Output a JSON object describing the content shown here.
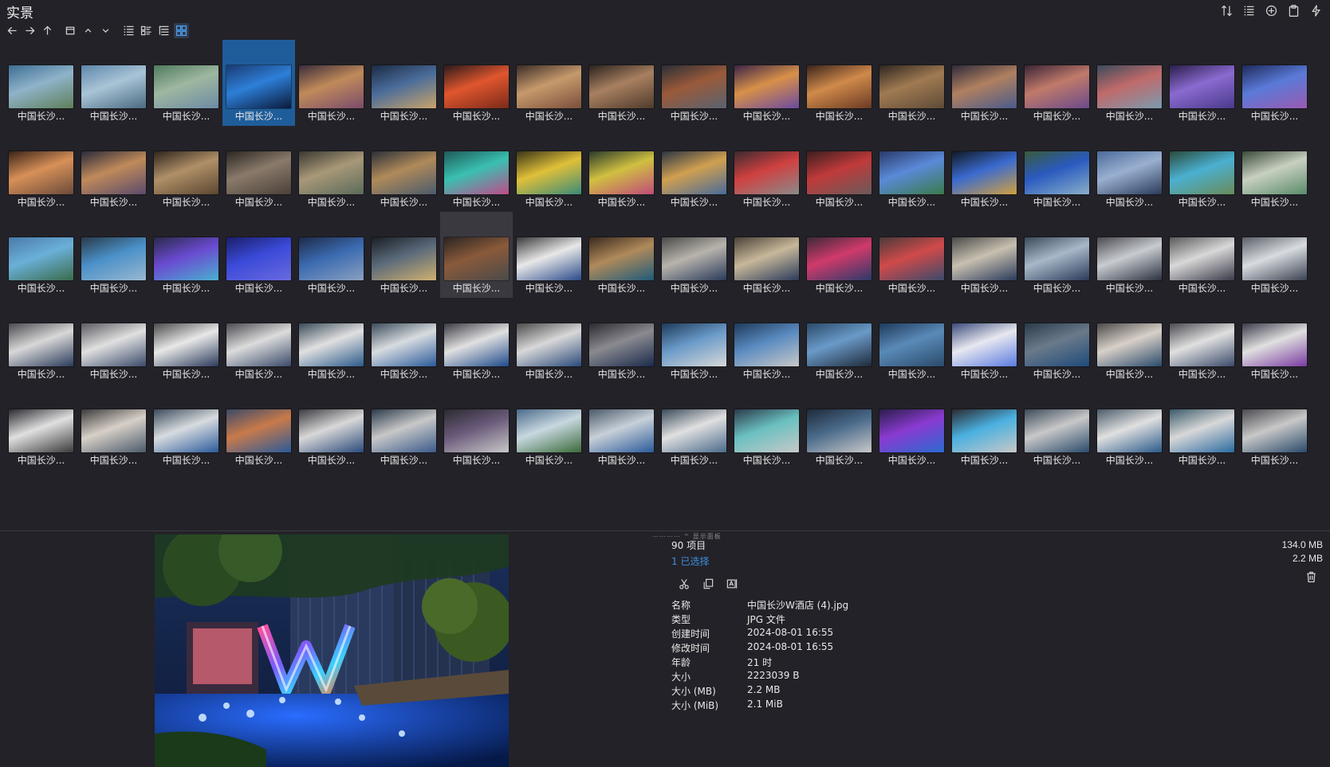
{
  "window": {
    "title": "实景"
  },
  "thumbnail_caption": "中国长沙...",
  "thumb_count": 90,
  "selected_index": 3,
  "hover_index": 42,
  "palette": [
    [
      "#3d6d94",
      "#8fb3c9",
      "#5e7f5a"
    ],
    [
      "#5d86ab",
      "#a9c4d6",
      "#4a6a80"
    ],
    [
      "#4f7b5e",
      "#9eb7a0",
      "#6c8aa4"
    ],
    [
      "#1b3a73",
      "#2d7fd8",
      "#0b1a3a"
    ],
    [
      "#3a2c3a",
      "#c08a5a",
      "#7a4b6a"
    ],
    [
      "#1b2a44",
      "#4a6c9a",
      "#c9a46a"
    ],
    [
      "#2a1a1a",
      "#e0562e",
      "#7a2a1a"
    ],
    [
      "#3b2c26",
      "#c69a6c",
      "#7a4e3a"
    ],
    [
      "#2a221e",
      "#a88060",
      "#4e3a2c"
    ],
    [
      "#2a2e36",
      "#9a5a3a",
      "#5a6270"
    ],
    [
      "#3a2448",
      "#d89048",
      "#6a4aa0"
    ],
    [
      "#3a241c",
      "#d08a4a",
      "#6a3a24"
    ],
    [
      "#2e2620",
      "#a07a52",
      "#5e4a36"
    ],
    [
      "#2e2a3a",
      "#b08060",
      "#4a5a8a"
    ],
    [
      "#3a2436",
      "#c07a6a",
      "#6a4a8a"
    ],
    [
      "#3a4a5a",
      "#c06a6a",
      "#7a9ab0"
    ],
    [
      "#2a1e4a",
      "#8a6ad0",
      "#4a3a8a"
    ],
    [
      "#1e2a5a",
      "#5a7ad8",
      "#9a5ab0"
    ],
    [
      "#3a2418",
      "#d89058",
      "#6a4a3a"
    ],
    [
      "#2a2a3a",
      "#c08a5a",
      "#5a4a6a"
    ],
    [
      "#2e241c",
      "#b09068",
      "#5a4630"
    ],
    [
      "#2a2622",
      "#8a7a6a",
      "#4a4038"
    ],
    [
      "#3a3830",
      "#a89878",
      "#5a6a5a"
    ],
    [
      "#2a3038",
      "#b08a5a",
      "#4a5a6a"
    ],
    [
      "#1e5a5a",
      "#3ac0b0",
      "#c04a8a"
    ],
    [
      "#3a3418",
      "#e0c038",
      "#3a8a7a"
    ],
    [
      "#2a3a2a",
      "#d0c040",
      "#c04a7a"
    ],
    [
      "#2a3444",
      "#d0a050",
      "#4a6a9a"
    ],
    [
      "#3a2a2e",
      "#d04040",
      "#8a8a8a"
    ],
    [
      "#3a1e1e",
      "#c03a3a",
      "#6a5a5a"
    ],
    [
      "#2a3a6a",
      "#5a8ad8",
      "#3a7a4a"
    ],
    [
      "#101820",
      "#3a6ad0",
      "#d0a040"
    ],
    [
      "#3a5a3a",
      "#2a5ac0",
      "#8ab0c8"
    ],
    [
      "#4a6a9a",
      "#9ab0d0",
      "#2a3a5a"
    ],
    [
      "#2a4a3a",
      "#4ab0d0",
      "#6a8a5a"
    ],
    [
      "#3a4a3a",
      "#c8d0c0",
      "#5a8a6a"
    ],
    [
      "#4a7aa8",
      "#6ab0d8",
      "#3a6a4a"
    ],
    [
      "#2a3a4a",
      "#4a90c8",
      "#9ab8d0"
    ],
    [
      "#2a2a4a",
      "#6a4ad0",
      "#4ab0d0"
    ],
    [
      "#1a1e6a",
      "#3a4ad8",
      "#6a6ae0"
    ],
    [
      "#1e2a48",
      "#3a6ab0",
      "#8aa0c0"
    ],
    [
      "#1a1e24",
      "#5a6a7a",
      "#d0b070"
    ],
    [
      "#2a2422",
      "#8a5a3a",
      "#4a4a4a"
    ],
    [
      "#3a3a3a",
      "#e8e8e8",
      "#2a4a8a"
    ],
    [
      "#3a2a1e",
      "#b08a5a",
      "#1e5a7a"
    ],
    [
      "#4a4a4a",
      "#b8b4ac",
      "#2a3a5a"
    ],
    [
      "#4a4238",
      "#c8b89a",
      "#2a3a5a"
    ],
    [
      "#3a2a3a",
      "#d03a6a",
      "#2a3a6a"
    ],
    [
      "#4a3a3a",
      "#d04a4a",
      "#3a4a6a"
    ],
    [
      "#4a4a4a",
      "#c8c0b0",
      "#2a3a5a"
    ],
    [
      "#3a4a5a",
      "#a8b8c8",
      "#2a3a5a"
    ],
    [
      "#4a4a50",
      "#c8ccd0",
      "#2a3040"
    ],
    [
      "#5a5a5a",
      "#d8d8d8",
      "#3a3a4a"
    ],
    [
      "#5a6068",
      "#d8dce0",
      "#3a4050"
    ],
    [
      "#4a4a50",
      "#d8d8d8",
      "#2a3a5a"
    ],
    [
      "#5a5a60",
      "#e0e0e0",
      "#3a4a6a"
    ],
    [
      "#4a4a4a",
      "#e8e8e8",
      "#2a3a5a"
    ],
    [
      "#4a4a50",
      "#dcdcdc",
      "#3a4a6a"
    ],
    [
      "#3a4a5a",
      "#e0e0e0",
      "#2a5a8a"
    ],
    [
      "#3a4a5a",
      "#d8dce0",
      "#2a5a9a"
    ],
    [
      "#3a3a44",
      "#e0e0e0",
      "#1e4a8a"
    ],
    [
      "#4a4a4a",
      "#d8d8d8",
      "#2a4a7a"
    ],
    [
      "#2a2a30",
      "#8a8a90",
      "#1a2a4a"
    ],
    [
      "#1e3a5a",
      "#6a9ac8",
      "#d8d8d8"
    ],
    [
      "#1e3a5a",
      "#5a8ac0",
      "#c8c8c8"
    ],
    [
      "#2a4a6a",
      "#6a9ac8",
      "#1e2a3a"
    ],
    [
      "#1e3a5a",
      "#5a8ab8",
      "#2a4a6a"
    ],
    [
      "#3a4a7a",
      "#e8e8f0",
      "#5a7ae0"
    ],
    [
      "#2a3a4a",
      "#6a7a8a",
      "#1e4a7a"
    ],
    [
      "#4a4a4a",
      "#d8d0c8",
      "#2a4a6a"
    ],
    [
      "#4a4a50",
      "#e0e0e0",
      "#3a4a6a"
    ],
    [
      "#3a3a4a",
      "#e0e0e0",
      "#7a3aa0"
    ],
    [
      "#2a2a30",
      "#e0e0e0",
      "#3a3a3a"
    ],
    [
      "#3a3a3a",
      "#d8d0c8",
      "#4a5a6a"
    ],
    [
      "#3a4a5a",
      "#d8dce0",
      "#2a5a9a"
    ],
    [
      "#3a4a6a",
      "#c87a4a",
      "#2a5a9a"
    ],
    [
      "#3a3a40",
      "#d8d8d8",
      "#2a4a7a"
    ],
    [
      "#2a3a4a",
      "#c8c8c8",
      "#3a5a8a"
    ],
    [
      "#2a2a30",
      "#6a5a7a",
      "#c8c8c8"
    ],
    [
      "#4a6a8a",
      "#c8d8e0",
      "#3a6a3a"
    ],
    [
      "#4a5a6a",
      "#c8d0d8",
      "#2a5a9a"
    ],
    [
      "#3a4a5a",
      "#e0e0e0",
      "#4a6a8a"
    ],
    [
      "#2a3a4a",
      "#6ac0c0",
      "#c8c8c8"
    ],
    [
      "#1e2a3a",
      "#4a6a8a",
      "#c8c8c8"
    ],
    [
      "#2a1e4a",
      "#8a3ad0",
      "#2a6ad0"
    ],
    [
      "#2a2a30",
      "#4ab0e0",
      "#c8c8c8"
    ],
    [
      "#3a4a5a",
      "#c8c8c8",
      "#2a4a6a"
    ],
    [
      "#4a5a6a",
      "#e0e0e0",
      "#2a5a8a"
    ],
    [
      "#3a5a6a",
      "#d8d8d8",
      "#2a6aa0"
    ],
    [
      "#4a4a50",
      "#c8c8c8",
      "#2a4a6a"
    ]
  ],
  "status": {
    "item_count": "90 项目",
    "selected_count": "1 已选择",
    "total_size": "134.0 MB",
    "selected_size": "2.2 MB",
    "grip": "⋯⋯⋯⋯  ^  显示面板"
  },
  "properties": [
    {
      "key": "名称",
      "value": "中国长沙W酒店 (4).jpg"
    },
    {
      "key": "类型",
      "value": "JPG 文件"
    },
    {
      "key": "创建时间",
      "value": "2024-08-01  16:55"
    },
    {
      "key": "修改时间",
      "value": "2024-08-01  16:55"
    },
    {
      "key": "年龄",
      "value": "21 时"
    },
    {
      "key": "大小",
      "value": "2223039 B"
    },
    {
      "key": "大小 (MB)",
      "value": "2.2 MB"
    },
    {
      "key": "大小 (MiB)",
      "value": "2.1 MiB"
    }
  ],
  "icons": {
    "toolbar": [
      "back-arrow-icon",
      "forward-arrow-icon",
      "up-arrow-icon",
      "window-icon",
      "sort-up-icon",
      "sort-down-icon",
      "list-icon",
      "details-icon",
      "tree-icon",
      "thumbnails-icon"
    ],
    "topright": [
      "sort-icon",
      "panel-icon",
      "add-icon",
      "clipboard-icon",
      "lightning-icon"
    ],
    "actions": [
      "cut-icon",
      "copy-icon",
      "rename-icon"
    ]
  }
}
